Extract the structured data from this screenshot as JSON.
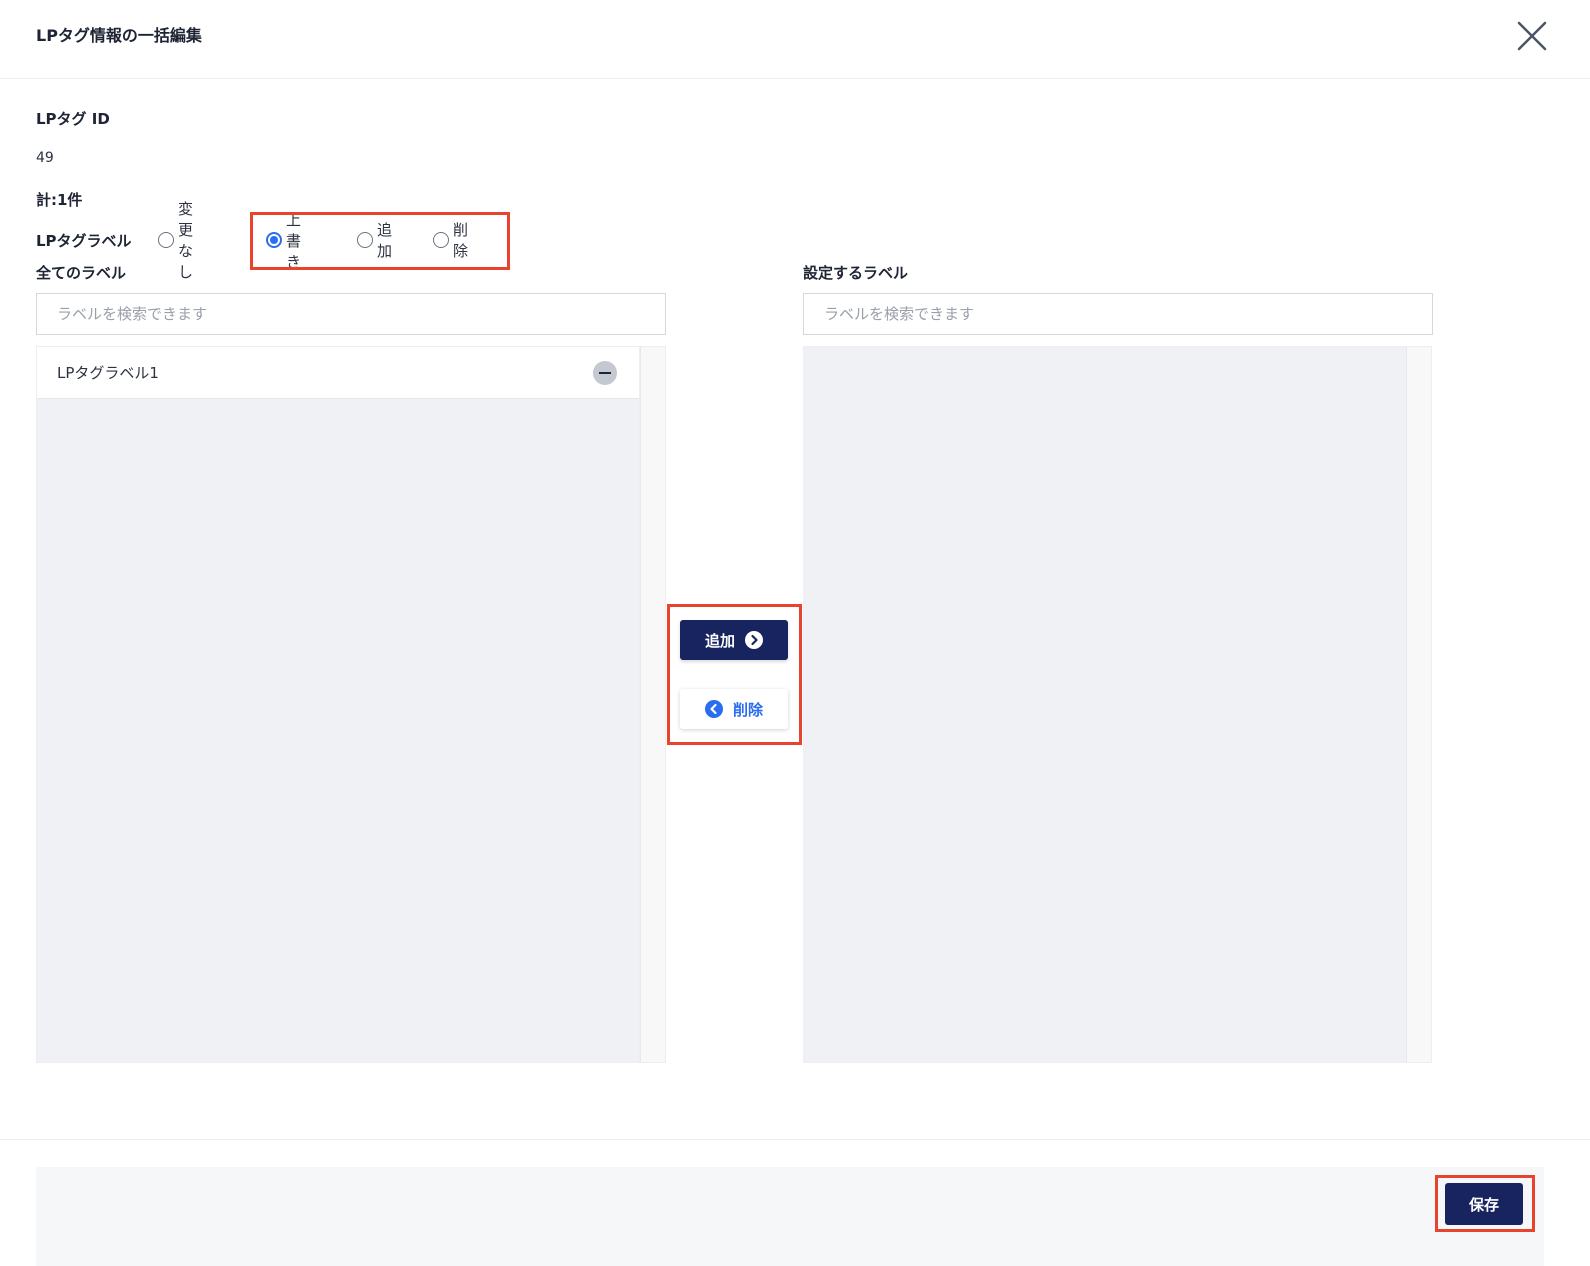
{
  "dialog": {
    "title": "LPタグ情報の一括編集",
    "close_icon": "close-icon"
  },
  "fields": {
    "id_label": "LPタグ ID",
    "id_value": "49",
    "total": "計:1件"
  },
  "label_mode": {
    "label": "LPタグラベル",
    "options": [
      {
        "label": "変更なし",
        "checked": false
      },
      {
        "label": "上書き",
        "checked": true
      },
      {
        "label": "追加",
        "checked": false
      },
      {
        "label": "削除",
        "checked": false
      }
    ]
  },
  "all_labels": {
    "heading": "全てのラベル",
    "search_placeholder": "ラベルを検索できます",
    "items": [
      {
        "label": "LPタグラベル1",
        "icon": "remove-icon"
      }
    ]
  },
  "set_labels": {
    "heading": "設定するラベル",
    "search_placeholder": "ラベルを検索できます",
    "items": []
  },
  "transfer": {
    "add_label": "追加",
    "add_icon": "chevron-right-circle-icon",
    "delete_label": "削除",
    "delete_icon": "chevron-left-circle-icon"
  },
  "footer": {
    "save_label": "保存"
  },
  "colors": {
    "primary": "#17245f",
    "accent": "#2b6df0",
    "highlight": "#e8432d",
    "panel": "#f0f1f4"
  }
}
